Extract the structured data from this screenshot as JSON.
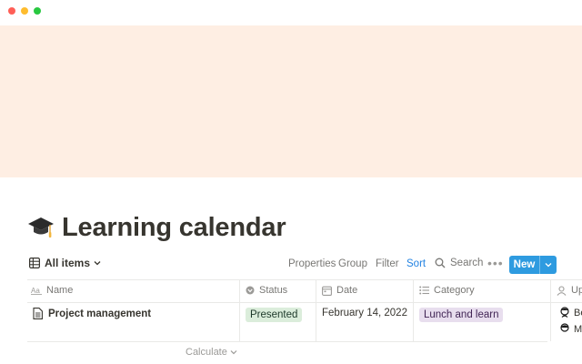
{
  "window": {
    "controls": [
      "close",
      "minimize",
      "zoom"
    ]
  },
  "cover": {
    "color": "#feeee3"
  },
  "page": {
    "icon": "graduation-cap-icon",
    "title": "Learning calendar"
  },
  "toolbar": {
    "view_label": "All items",
    "properties_label": "Properties",
    "group_label": "Group",
    "filter_label": "Filter",
    "sort_label": "Sort",
    "search_label": "Search",
    "more_label": "•••",
    "new_label": "New",
    "accent_color": "#2e9be0"
  },
  "table": {
    "columns": [
      {
        "label": "Name",
        "icon": "text-icon"
      },
      {
        "label": "Status",
        "icon": "status-icon"
      },
      {
        "label": "Date",
        "icon": "calendar-icon"
      },
      {
        "label": "Category",
        "icon": "list-icon"
      },
      {
        "label": "Up",
        "icon": "person-icon"
      }
    ],
    "rows": [
      {
        "name": "Project management",
        "status": "Presented",
        "date": "February 14, 2022",
        "category": "Lunch and learn",
        "uploader_first": "Be",
        "uploader_second": "M"
      }
    ]
  },
  "footer": {
    "calculate_label": "Calculate"
  }
}
